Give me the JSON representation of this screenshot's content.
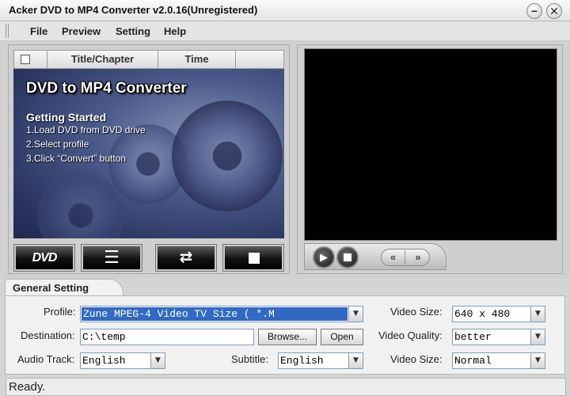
{
  "window": {
    "title": "Acker DVD to MP4 Converter v2.0.16(Unregistered)",
    "minimize_glyph": "−",
    "close_glyph": "✕"
  },
  "menu": {
    "items": [
      "File",
      "Preview",
      "Setting",
      "Help"
    ]
  },
  "list": {
    "col_title": "Title/Chapter",
    "col_time": "Time"
  },
  "preview": {
    "app_name": "DVD to MP4 Converter",
    "heading": "Getting Started",
    "steps": [
      "1.Load DVD from DVD drive",
      "2.Select profile",
      "3.Click “Convert” button"
    ]
  },
  "toolbar": {
    "dvd_label": "DVD",
    "list_glyph": "☰",
    "convert_glyph": "⇄"
  },
  "player": {
    "play_glyph": "▶",
    "rewind_glyph": "«",
    "forward_glyph": "»"
  },
  "settings": {
    "tab_label": "General Setting",
    "profile_label": "Profile:",
    "profile_value": "Zune MPEG-4 Video TV Size          ( *.M",
    "destination_label": "Destination:",
    "destination_value": "C:\\temp",
    "browse_label": "Browse...",
    "open_label": "Open",
    "audio_track_label": "Audio Track:",
    "audio_track_value": "English",
    "subtitle_label": "Subtitle:",
    "subtitle_value": "English",
    "video_size_label": "Video Size:",
    "video_size_value": "640 x 480",
    "video_quality_label": "Video Quality:",
    "video_quality_value": "better",
    "video_size2_label": "Video Size:",
    "video_size2_value": "Normal",
    "dropdown_glyph": "▼"
  },
  "status": {
    "text": "Ready."
  },
  "colors": {
    "selection": "#316ac5",
    "video_screen": "#000000",
    "preview_bg": "#3b4677"
  }
}
